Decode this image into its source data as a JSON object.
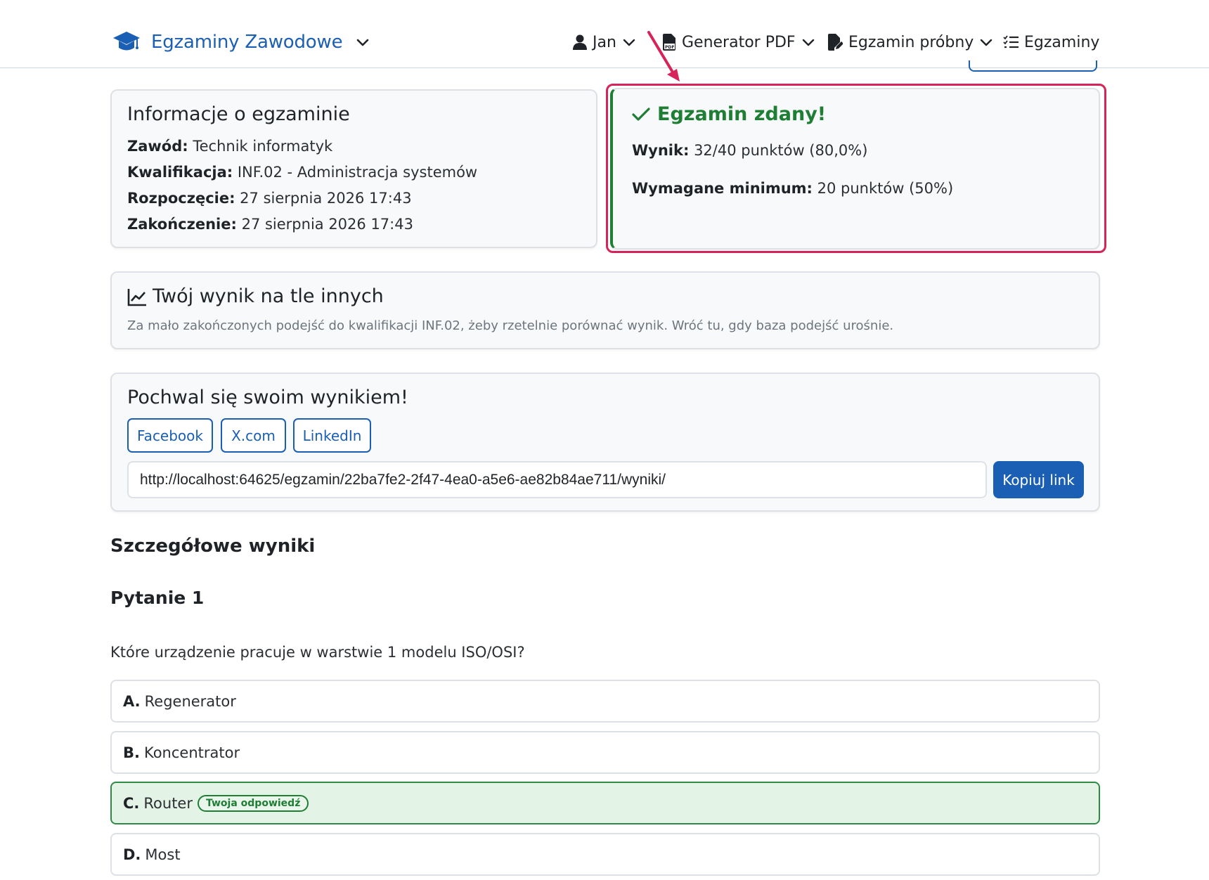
{
  "nav": {
    "brand": "Egzaminy Zawodowe",
    "user": "Jan",
    "pdf_generator": "Generator PDF",
    "practice_exam": "Egzamin próbny",
    "exams": "Egzaminy"
  },
  "exam_info": {
    "title": "Informacje o egzaminie",
    "profession_label": "Zawód:",
    "profession_value": "Technik informatyk",
    "qualification_label": "Kwalifikacja:",
    "qualification_value": "INF.02 - Administracja systemów",
    "start_label": "Rozpoczęcie:",
    "start_value": "27 sierpnia 2026 17:43",
    "end_label": "Zakończenie:",
    "end_value": "27 sierpnia 2026 17:43"
  },
  "result": {
    "title": "Egzamin zdany!",
    "score_label": "Wynik:",
    "score_value": "32/40 punktów (80,0%)",
    "min_label": "Wymagane minimum:",
    "min_value": "20 punktów (50%)"
  },
  "comparison": {
    "title": "Twój wynik na tle innych",
    "message": "Za mało zakończonych podejść do kwalifikacji INF.02, żeby rzetelnie porównać wynik. Wróć tu, gdy baza podejść urośnie."
  },
  "share": {
    "title": "Pochwal się swoim wynikiem!",
    "facebook": "Facebook",
    "x": "X.com",
    "linkedin": "LinkedIn",
    "url": "http://localhost:64625/egzamin/22ba7fe2-2f47-4ea0-a5e6-ae82b84ae711/wyniki/",
    "copy": "Kopiuj link"
  },
  "details": {
    "title": "Szczegółowe wyniki",
    "question_title": "Pytanie 1",
    "question_text": "Które urządzenie pracuje w warstwie 1 modelu ISO/OSI?",
    "answers": [
      {
        "letter": "A.",
        "text": "Regenerator"
      },
      {
        "letter": "B.",
        "text": "Koncentrator"
      },
      {
        "letter": "C.",
        "text": "Router",
        "badge": "Twoja odpowiedź"
      },
      {
        "letter": "D.",
        "text": "Most"
      }
    ]
  },
  "colors": {
    "brand": "#1a5fb4",
    "success": "#1e7e34",
    "highlight": "#d6245a"
  }
}
